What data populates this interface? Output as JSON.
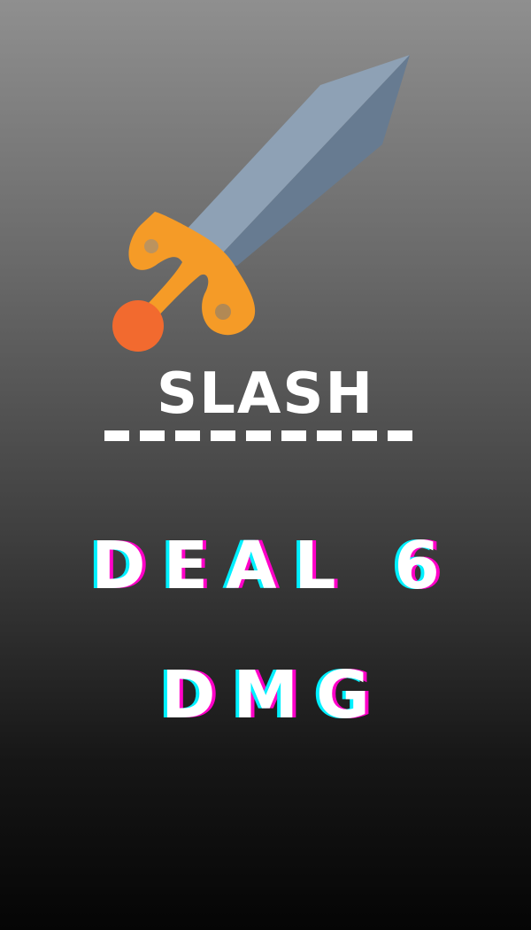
{
  "card": {
    "title": "SLASH",
    "effect_line_1": "DEAL 6",
    "effect_line_2": "DMG",
    "art_icon": "sword-icon"
  },
  "colors": {
    "blade_light": "#8ea1b5",
    "blade_dark": "#677b91",
    "hilt": "#f59b27",
    "pommel": "#f26a2f",
    "text": "#ffffff",
    "glitch_cyan": "#00f0ff",
    "glitch_magenta": "#ff00c8"
  }
}
